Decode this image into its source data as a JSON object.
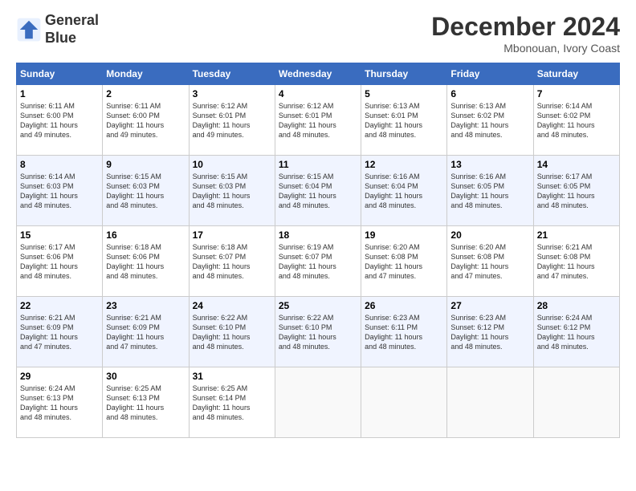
{
  "logo": {
    "line1": "General",
    "line2": "Blue"
  },
  "title": "December 2024",
  "location": "Mbonouan, Ivory Coast",
  "days_header": [
    "Sunday",
    "Monday",
    "Tuesday",
    "Wednesday",
    "Thursday",
    "Friday",
    "Saturday"
  ],
  "weeks": [
    [
      {
        "day": "1",
        "info": "Sunrise: 6:11 AM\nSunset: 6:00 PM\nDaylight: 11 hours\nand 49 minutes."
      },
      {
        "day": "2",
        "info": "Sunrise: 6:11 AM\nSunset: 6:00 PM\nDaylight: 11 hours\nand 49 minutes."
      },
      {
        "day": "3",
        "info": "Sunrise: 6:12 AM\nSunset: 6:01 PM\nDaylight: 11 hours\nand 49 minutes."
      },
      {
        "day": "4",
        "info": "Sunrise: 6:12 AM\nSunset: 6:01 PM\nDaylight: 11 hours\nand 48 minutes."
      },
      {
        "day": "5",
        "info": "Sunrise: 6:13 AM\nSunset: 6:01 PM\nDaylight: 11 hours\nand 48 minutes."
      },
      {
        "day": "6",
        "info": "Sunrise: 6:13 AM\nSunset: 6:02 PM\nDaylight: 11 hours\nand 48 minutes."
      },
      {
        "day": "7",
        "info": "Sunrise: 6:14 AM\nSunset: 6:02 PM\nDaylight: 11 hours\nand 48 minutes."
      }
    ],
    [
      {
        "day": "8",
        "info": "Sunrise: 6:14 AM\nSunset: 6:03 PM\nDaylight: 11 hours\nand 48 minutes."
      },
      {
        "day": "9",
        "info": "Sunrise: 6:15 AM\nSunset: 6:03 PM\nDaylight: 11 hours\nand 48 minutes."
      },
      {
        "day": "10",
        "info": "Sunrise: 6:15 AM\nSunset: 6:03 PM\nDaylight: 11 hours\nand 48 minutes."
      },
      {
        "day": "11",
        "info": "Sunrise: 6:15 AM\nSunset: 6:04 PM\nDaylight: 11 hours\nand 48 minutes."
      },
      {
        "day": "12",
        "info": "Sunrise: 6:16 AM\nSunset: 6:04 PM\nDaylight: 11 hours\nand 48 minutes."
      },
      {
        "day": "13",
        "info": "Sunrise: 6:16 AM\nSunset: 6:05 PM\nDaylight: 11 hours\nand 48 minutes."
      },
      {
        "day": "14",
        "info": "Sunrise: 6:17 AM\nSunset: 6:05 PM\nDaylight: 11 hours\nand 48 minutes."
      }
    ],
    [
      {
        "day": "15",
        "info": "Sunrise: 6:17 AM\nSunset: 6:06 PM\nDaylight: 11 hours\nand 48 minutes."
      },
      {
        "day": "16",
        "info": "Sunrise: 6:18 AM\nSunset: 6:06 PM\nDaylight: 11 hours\nand 48 minutes."
      },
      {
        "day": "17",
        "info": "Sunrise: 6:18 AM\nSunset: 6:07 PM\nDaylight: 11 hours\nand 48 minutes."
      },
      {
        "day": "18",
        "info": "Sunrise: 6:19 AM\nSunset: 6:07 PM\nDaylight: 11 hours\nand 48 minutes."
      },
      {
        "day": "19",
        "info": "Sunrise: 6:20 AM\nSunset: 6:08 PM\nDaylight: 11 hours\nand 47 minutes."
      },
      {
        "day": "20",
        "info": "Sunrise: 6:20 AM\nSunset: 6:08 PM\nDaylight: 11 hours\nand 47 minutes."
      },
      {
        "day": "21",
        "info": "Sunrise: 6:21 AM\nSunset: 6:08 PM\nDaylight: 11 hours\nand 47 minutes."
      }
    ],
    [
      {
        "day": "22",
        "info": "Sunrise: 6:21 AM\nSunset: 6:09 PM\nDaylight: 11 hours\nand 47 minutes."
      },
      {
        "day": "23",
        "info": "Sunrise: 6:21 AM\nSunset: 6:09 PM\nDaylight: 11 hours\nand 47 minutes."
      },
      {
        "day": "24",
        "info": "Sunrise: 6:22 AM\nSunset: 6:10 PM\nDaylight: 11 hours\nand 48 minutes."
      },
      {
        "day": "25",
        "info": "Sunrise: 6:22 AM\nSunset: 6:10 PM\nDaylight: 11 hours\nand 48 minutes."
      },
      {
        "day": "26",
        "info": "Sunrise: 6:23 AM\nSunset: 6:11 PM\nDaylight: 11 hours\nand 48 minutes."
      },
      {
        "day": "27",
        "info": "Sunrise: 6:23 AM\nSunset: 6:12 PM\nDaylight: 11 hours\nand 48 minutes."
      },
      {
        "day": "28",
        "info": "Sunrise: 6:24 AM\nSunset: 6:12 PM\nDaylight: 11 hours\nand 48 minutes."
      }
    ],
    [
      {
        "day": "29",
        "info": "Sunrise: 6:24 AM\nSunset: 6:13 PM\nDaylight: 11 hours\nand 48 minutes."
      },
      {
        "day": "30",
        "info": "Sunrise: 6:25 AM\nSunset: 6:13 PM\nDaylight: 11 hours\nand 48 minutes."
      },
      {
        "day": "31",
        "info": "Sunrise: 6:25 AM\nSunset: 6:14 PM\nDaylight: 11 hours\nand 48 minutes."
      },
      {
        "day": "",
        "info": ""
      },
      {
        "day": "",
        "info": ""
      },
      {
        "day": "",
        "info": ""
      },
      {
        "day": "",
        "info": ""
      }
    ]
  ]
}
